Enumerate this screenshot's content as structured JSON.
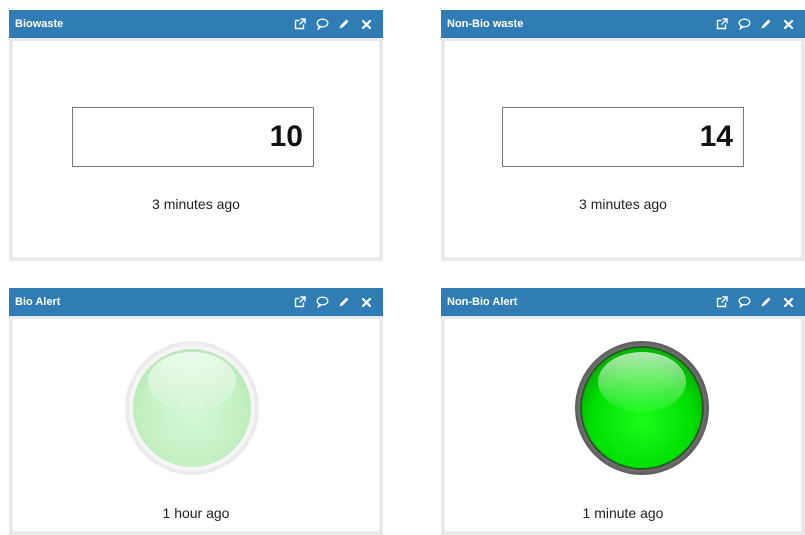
{
  "widgets": [
    {
      "title": "Biowaste",
      "value": "10",
      "timestamp": "3 minutes ago",
      "tools": [
        "external-link-icon",
        "comment-icon",
        "pencil-icon",
        "close-icon"
      ]
    },
    {
      "title": "Non-Bio waste",
      "value": "14",
      "timestamp": "3 minutes ago",
      "tools": [
        "external-link-icon",
        "comment-icon",
        "pencil-icon",
        "close-icon"
      ]
    },
    {
      "title": "Bio Alert",
      "led_state": "off",
      "timestamp": "1 hour ago",
      "tools": [
        "external-link-icon",
        "comment-icon",
        "pencil-icon",
        "close-icon"
      ]
    },
    {
      "title": "Non-Bio Alert",
      "led_state": "on",
      "timestamp": "1 minute ago",
      "tools": [
        "external-link-icon",
        "comment-icon",
        "pencil-icon",
        "close-icon"
      ]
    }
  ],
  "colors": {
    "header": "#2f7db4",
    "led_off": "#c8f5c8",
    "led_on": "#00e600"
  }
}
